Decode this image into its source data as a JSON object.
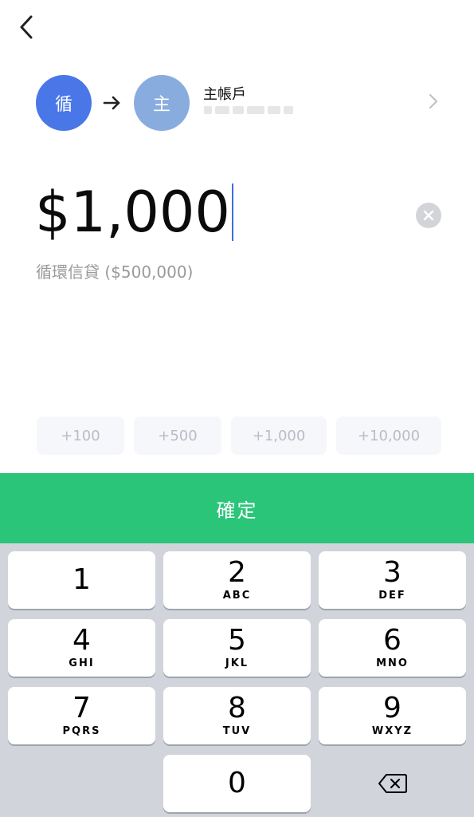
{
  "transfer": {
    "from_avatar": "循",
    "to_avatar": "主",
    "to_name": "主帳戶",
    "colors": {
      "from": "#4a77e8",
      "to": "#89acdf"
    }
  },
  "amount": {
    "value": "$1,000",
    "source": "循環信貸 ($500,000)"
  },
  "quick_add": [
    "+100",
    "+500",
    "+1,000",
    "+10,000"
  ],
  "confirm_label": "確定",
  "keypad": [
    {
      "num": "1",
      "letters": ""
    },
    {
      "num": "2",
      "letters": "ABC"
    },
    {
      "num": "3",
      "letters": "DEF"
    },
    {
      "num": "4",
      "letters": "GHI"
    },
    {
      "num": "5",
      "letters": "JKL"
    },
    {
      "num": "6",
      "letters": "MNO"
    },
    {
      "num": "7",
      "letters": "PQRS"
    },
    {
      "num": "8",
      "letters": "TUV"
    },
    {
      "num": "9",
      "letters": "WXYZ"
    },
    {
      "num": "0",
      "letters": ""
    }
  ],
  "icons": {
    "back": "chevron-left-icon",
    "arrow": "arrow-right-icon",
    "chevron": "chevron-right-icon",
    "clear": "clear-icon",
    "backspace": "backspace-icon"
  }
}
